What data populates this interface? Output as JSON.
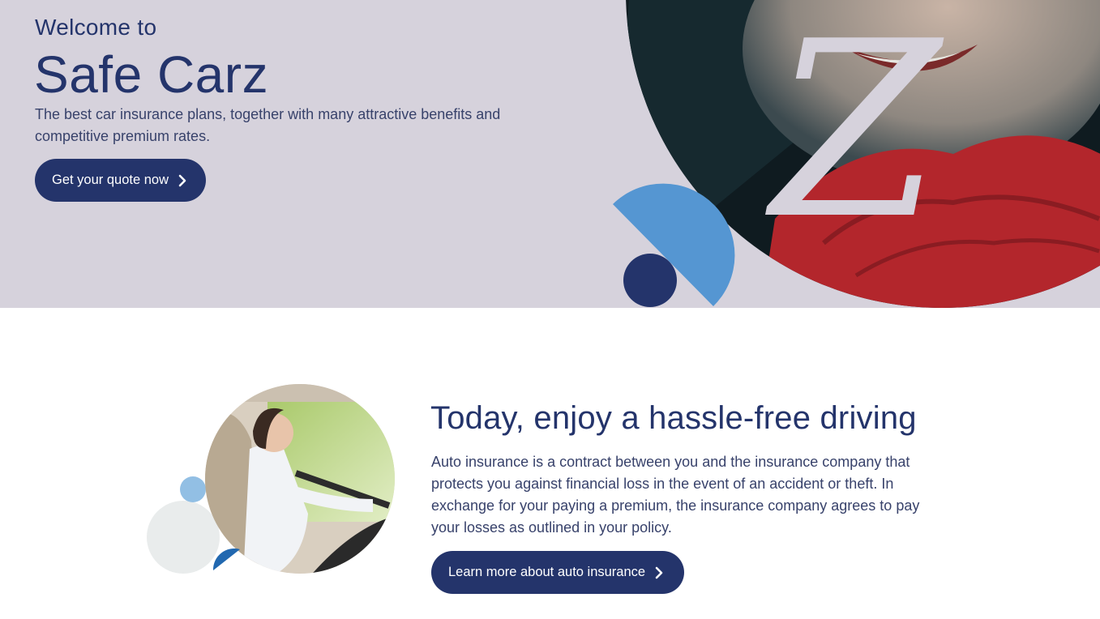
{
  "hero": {
    "welcome": "Welcome to",
    "title": "Safe Carz",
    "subtitle": "The best car insurance plans, together with many attractive benefits and competitive premium rates.",
    "cta_label": "Get your quote now",
    "cta_icon": "chevron-right-icon",
    "logo_letter": "Z"
  },
  "feature": {
    "title": "Today, enjoy a hassle-free driving",
    "body": "Auto insurance is a contract between you and the insurance company that protects you against financial loss in the event of an accident or theft. In exchange for your paying a premium, the insurance company agrees to pay your losses as outlined in your policy.",
    "cta_label": "Learn more about auto insurance",
    "cta_icon": "chevron-right-icon"
  },
  "colors": {
    "navy": "#24346b",
    "hero_bg": "#d6d2dc",
    "accent_blue": "#5596d2",
    "light_blue": "#92bfe4",
    "pale_gray": "#e9ecec"
  }
}
